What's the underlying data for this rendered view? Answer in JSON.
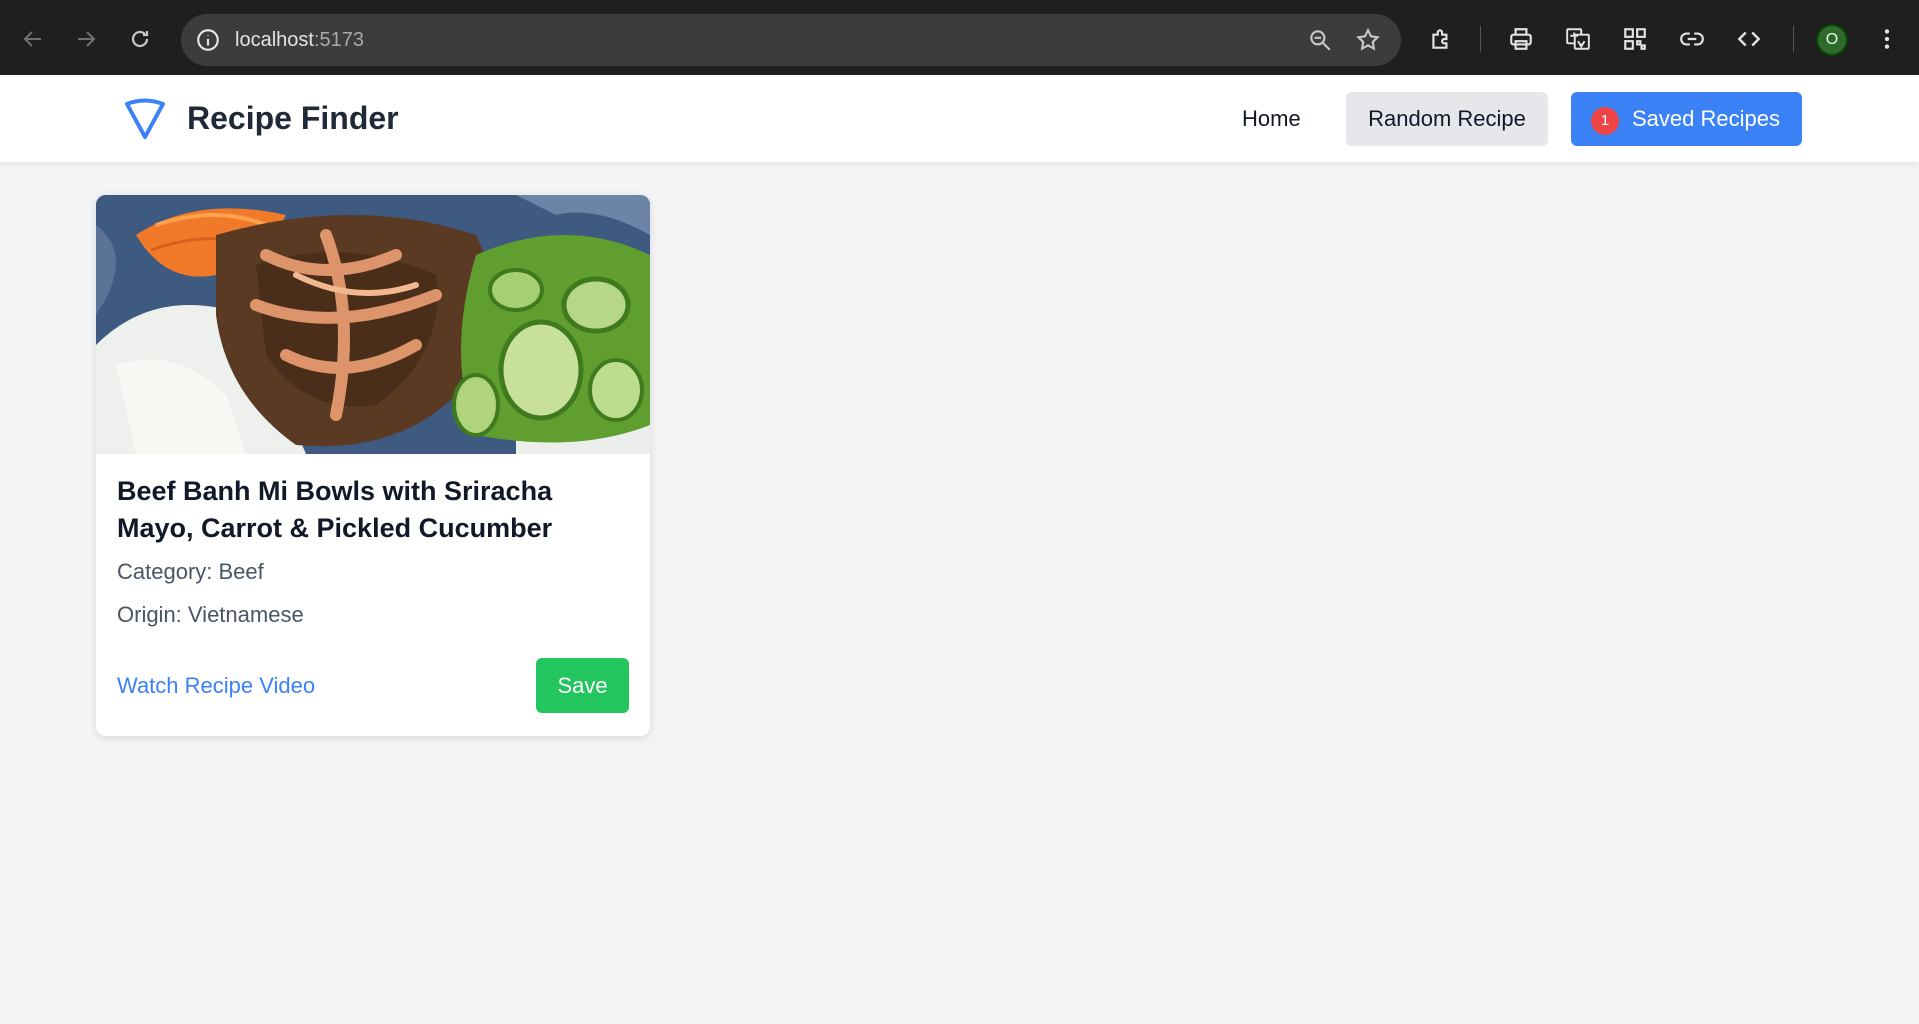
{
  "browser": {
    "url_host": "localhost",
    "url_port": ":5173",
    "profile_initial": "O",
    "icons": [
      "back-icon",
      "forward-icon",
      "reload-icon",
      "site-info-icon",
      "zoom-icon",
      "bookmark-star-icon",
      "extensions-icon",
      "print-icon",
      "translate-icon",
      "qr-code-icon",
      "link-icon",
      "code-icon",
      "menu-dots-icon"
    ]
  },
  "navbar": {
    "brand": "Recipe Finder",
    "home_label": "Home",
    "random_label": "Random Recipe",
    "saved_label": "Saved Recipes",
    "saved_count": "1"
  },
  "recipes": [
    {
      "title": "Beef Banh Mi Bowls with Sriracha Mayo, Carrot & Pickled Cucumber",
      "category": "Category: Beef",
      "origin": "Origin: Vietnamese",
      "video_label": "Watch Recipe Video",
      "save_label": "Save"
    }
  ],
  "colors": {
    "primary": "#3b82f6",
    "save": "#22c55e",
    "badge": "#ef4444",
    "background": "#f3f4f6"
  }
}
